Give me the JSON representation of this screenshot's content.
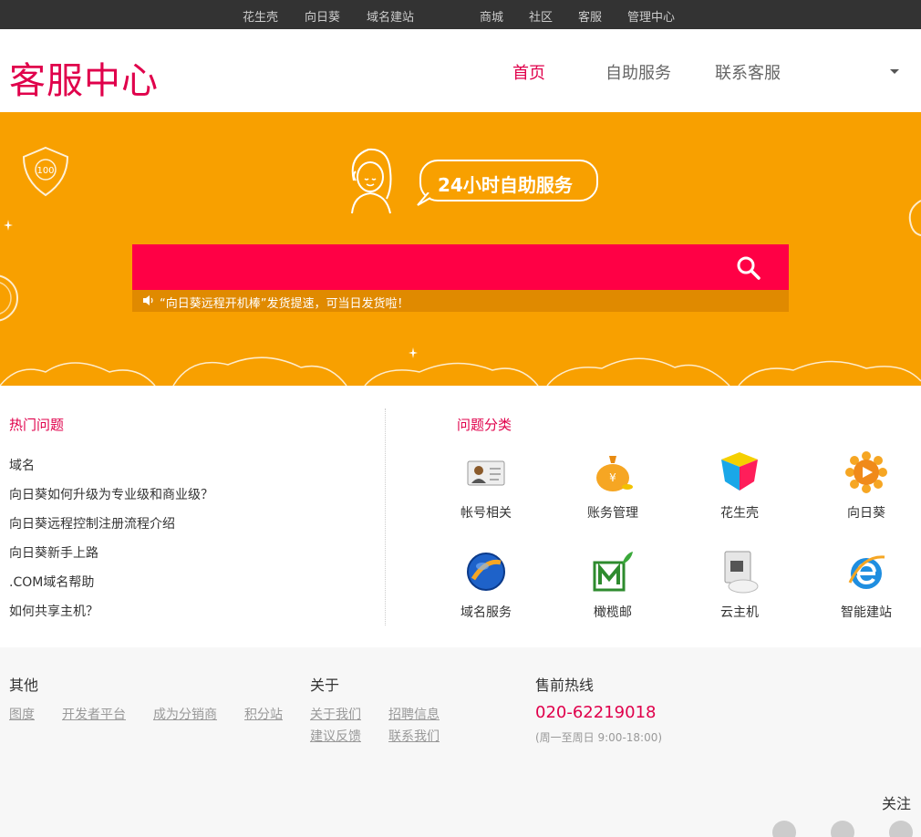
{
  "topbar": {
    "links": [
      "花生壳",
      "向日葵",
      "域名建站",
      "商城",
      "社区",
      "客服",
      "管理中心"
    ]
  },
  "header": {
    "logo": "客服中心",
    "nav": [
      "首页",
      "自助服务",
      "联系客服"
    ]
  },
  "banner": {
    "bubble": "24小时自助服务",
    "notice": "“向日葵远程开机棒”发货提速，可当日发货啦！",
    "badge": "100"
  },
  "hot": {
    "title": "热门问题",
    "items": [
      "域名",
      "向日葵如何升级为专业级和商业级？",
      "向日葵远程控制注册流程介绍",
      "向日葵新手上路",
      ".COM域名帮助",
      "如何共享主机？"
    ]
  },
  "categories": {
    "title": "问题分类",
    "items": [
      {
        "label": "帐号相关",
        "icon": "account-card-icon"
      },
      {
        "label": "账务管理",
        "icon": "money-bag-icon"
      },
      {
        "label": "花生壳",
        "icon": "cube-icon"
      },
      {
        "label": "向日葵",
        "icon": "sunflower-icon"
      },
      {
        "label": "域名服务",
        "icon": "globe-icon"
      },
      {
        "label": "橄榄邮",
        "icon": "mail-m-icon"
      },
      {
        "label": "云主机",
        "icon": "cloud-server-icon"
      },
      {
        "label": "智能建站",
        "icon": "ie-e-icon"
      }
    ]
  },
  "footer": {
    "other_title": "其他",
    "other_links": [
      "图度",
      "开发者平台",
      "成为分销商",
      "积分站"
    ],
    "about_title": "关于",
    "about_links": [
      "关于我们",
      "招聘信息",
      "建议反馈",
      "联系我们"
    ],
    "sales_title": "售前热线",
    "phone": "020-62219018",
    "hours": "(周一至周日 9:00-18:00)",
    "follow": "关注"
  },
  "colors": {
    "accent": "#e0004b",
    "banner": "#f8a000",
    "search": "#ff0045",
    "topbar": "#333333"
  }
}
